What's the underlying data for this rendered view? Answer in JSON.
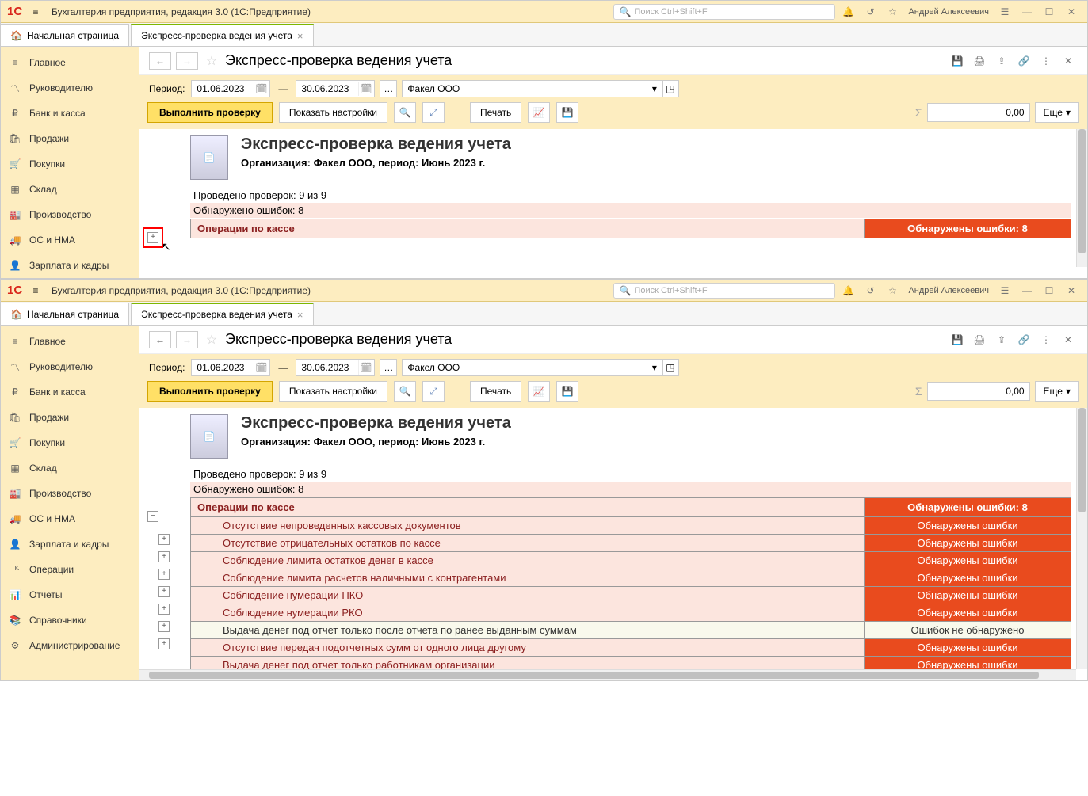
{
  "app_title": "Бухгалтерия предприятия, редакция 3.0  (1С:Предприятие)",
  "search_placeholder": "Поиск Ctrl+Shift+F",
  "user": "Андрей Алексеевич",
  "tabs": {
    "home": "Начальная страница",
    "active": "Экспресс-проверка ведения учета"
  },
  "sidebar": [
    {
      "label": "Главное",
      "icon": "≡"
    },
    {
      "label": "Руководителю",
      "icon": "〽"
    },
    {
      "label": "Банк и касса",
      "icon": "₽"
    },
    {
      "label": "Продажи",
      "icon": "🛍"
    },
    {
      "label": "Покупки",
      "icon": "🛒"
    },
    {
      "label": "Склад",
      "icon": "▦"
    },
    {
      "label": "Производство",
      "icon": "🏭"
    },
    {
      "label": "ОС и НМА",
      "icon": "🚚"
    },
    {
      "label": "Зарплата и кадры",
      "icon": "👤"
    }
  ],
  "sidebar_extra": [
    {
      "label": "Операции",
      "icon": "ᵀᴷ"
    },
    {
      "label": "Отчеты",
      "icon": "📊"
    },
    {
      "label": "Справочники",
      "icon": "📚"
    },
    {
      "label": "Администрирование",
      "icon": "⚙"
    }
  ],
  "page_title": "Экспресс-проверка ведения учета",
  "period_label": "Период:",
  "date_from": "01.06.2023",
  "date_to": "30.06.2023",
  "org": "Факел ООО",
  "btn_run": "Выполнить проверку",
  "btn_settings": "Показать настройки",
  "btn_print": "Печать",
  "sum_zero": "0,00",
  "btn_more": "Еще",
  "report": {
    "title": "Экспресс-проверка ведения учета",
    "subtitle": "Организация: Факел ООО, период: Июнь 2023 г.",
    "stats": {
      "done": "Проведено проверок: 9 из 9",
      "errors": "Обнаружено ошибок: 8"
    },
    "section": {
      "name": "Операции по кассе",
      "status": "Обнаружены ошибки: 8"
    }
  },
  "checks": [
    {
      "name": "Отсутствие непроведенных кассовых документов",
      "status": "Обнаружены ошибки",
      "ok": false
    },
    {
      "name": "Отсутствие отрицательных остатков по кассе",
      "status": "Обнаружены ошибки",
      "ok": false
    },
    {
      "name": "Соблюдение лимита остатков денег в кассе",
      "status": "Обнаружены ошибки",
      "ok": false
    },
    {
      "name": "Соблюдение лимита расчетов наличными с контрагентами",
      "status": "Обнаружены ошибки",
      "ok": false
    },
    {
      "name": "Соблюдение нумерации ПКО",
      "status": "Обнаружены ошибки",
      "ok": false
    },
    {
      "name": "Соблюдение нумерации РКО",
      "status": "Обнаружены ошибки",
      "ok": false
    },
    {
      "name": "Выдача денег под отчет только после отчета по ранее выданным суммам",
      "status": "Ошибок не обнаружено",
      "ok": true
    },
    {
      "name": "Отсутствие передач подотчетных сумм от одного лица другому",
      "status": "Обнаружены ошибки",
      "ok": false
    },
    {
      "name": "Выдача денег под отчет только работникам организации",
      "status": "Обнаружены ошибки",
      "ok": false
    }
  ]
}
